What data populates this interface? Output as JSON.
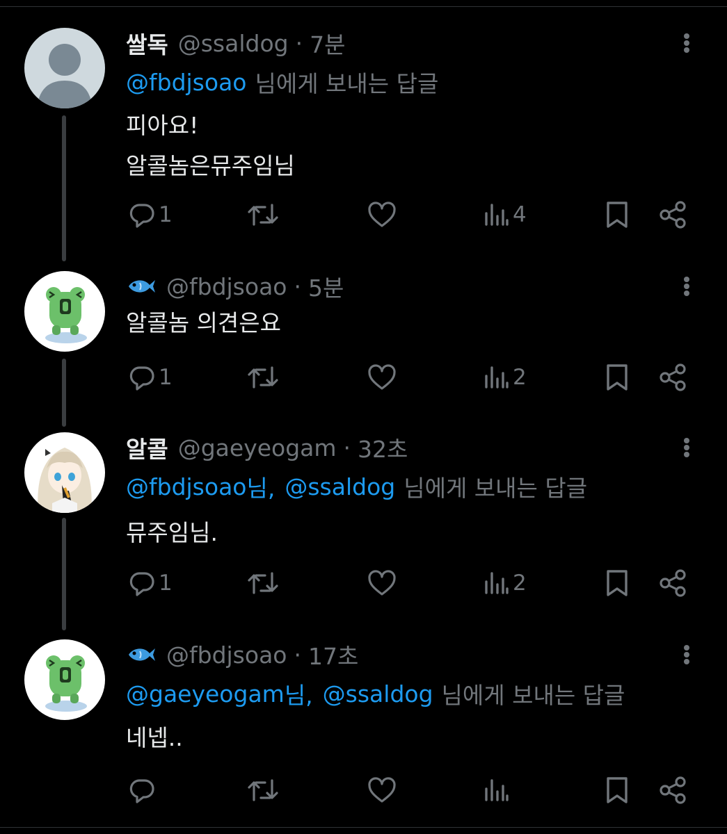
{
  "tweets": [
    {
      "display_name": "쌀독",
      "handle": "@ssaldog",
      "dot": "·",
      "time": "7분",
      "avatar": "default-avatar",
      "replying": {
        "mentions": [
          "@fbdjsoao"
        ],
        "separator": "",
        "suffix": "님에게 보내는 답글"
      },
      "text_lines": [
        "피아요!",
        "알콜놈은뮤주임님"
      ],
      "actions": {
        "reply": "1",
        "retweet": "",
        "like": "",
        "views": "4"
      }
    },
    {
      "display_name": "",
      "name_icon": "fish-emoji-icon",
      "handle": "@fbdjsoao",
      "dot": "·",
      "time": "5분",
      "avatar": "frog-avatar",
      "replying": null,
      "text_lines": [
        "알콜놈 의견은요"
      ],
      "actions": {
        "reply": "1",
        "retweet": "",
        "like": "",
        "views": "2"
      }
    },
    {
      "display_name": "알콜",
      "handle": "@gaeyeogam",
      "dot": "·",
      "time": "32초",
      "avatar": "anime-girl-avatar",
      "replying": {
        "mentions": [
          "@fbdjsoao",
          "@ssaldog"
        ],
        "separator": " 님,",
        "suffix": "님에게 보내는 답글"
      },
      "text_lines": [
        "뮤주임님."
      ],
      "actions": {
        "reply": "1",
        "retweet": "",
        "like": "",
        "views": "2"
      }
    },
    {
      "display_name": "",
      "name_icon": "fish-emoji-icon",
      "handle": "@fbdjsoao",
      "dot": "·",
      "time": "17초",
      "avatar": "frog-avatar",
      "replying": {
        "mentions": [
          "@gaeyeogam",
          "@ssaldog"
        ],
        "separator": " 님,",
        "suffix": "님에게 보내는 답글"
      },
      "text_lines": [
        "네넵.."
      ],
      "actions": {
        "reply": "",
        "retweet": "",
        "like": "",
        "views": ""
      }
    }
  ],
  "colors": {
    "background": "#000000",
    "text": "#e7e9ea",
    "muted": "#71767b",
    "mention": "#1d9bf0",
    "thread_line": "#3a3d40",
    "frog_green": "#6cc06a",
    "fish_blue": "#3d9be0"
  }
}
